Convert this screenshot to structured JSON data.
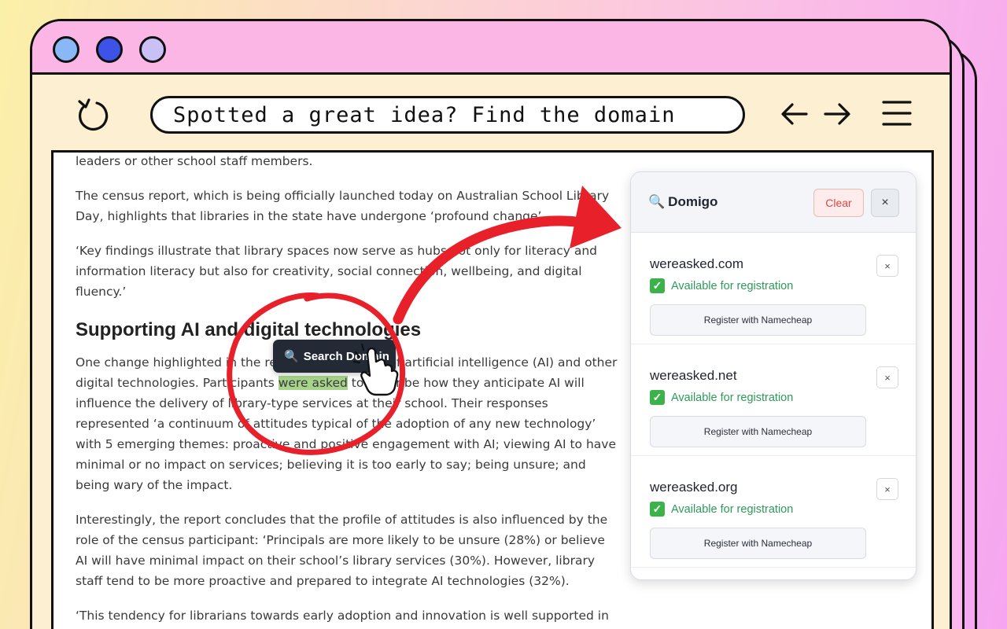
{
  "window": {
    "colors": {
      "dot1": "#8ab8f6",
      "dot2": "#3d52e6",
      "dot3": "#c9c0f6",
      "titlebar": "#fbb6e6"
    }
  },
  "toolbar": {
    "url_text": "Spotted a great idea? Find the domain",
    "icons": [
      "reload-icon",
      "back-arrow-icon",
      "forward-arrow-icon",
      "menu-icon"
    ]
  },
  "article": {
    "p0": "leaders or other school staff members.",
    "p1": "The census report, which is being officially launched today on Australian School Library Day, highlights that libraries in the state have undergone ‘profound change’.",
    "p2": "‘Key findings illustrate that library spaces now serve as hubs not only for literacy and information literacy but also for creativity, social connection, wellbeing, and digital fluency.’",
    "heading": "Supporting AI and digital technologies",
    "p3_before": "One change highlighted in the report is the impact of artificial intelligence (AI) and other digital technologies. Participants ",
    "p3_highlight": "were asked",
    "p3_after": " to describe how they anticipate AI will influence the delivery of library-type services at their school. Their responses represented ‘a continuum of attitudes typical of the adoption of any new technology’ with 5 emerging themes: proactive and positive engagement with AI; viewing AI to have minimal or no impact on services; believing it is too early to say; being unsure; and being wary of the impact.",
    "p4": "Interestingly, the report concludes that the profile of attitudes is also influenced by the role of the census participant: ‘Principals are more likely to be unsure (28%) or believe AI will have minimal impact on their school’s library services (30%). However, library staff tend to be more proactive and prepared to integrate AI technologies (32%).",
    "p5": "‘This tendency for librarians towards early adoption and innovation is well supported in"
  },
  "tooltip": {
    "label": "Search Domain",
    "icon": "magnifier-icon"
  },
  "panel": {
    "title": "Domigo",
    "clear_label": "Clear",
    "close_label": "×",
    "results": [
      {
        "domain": "wereasked.com",
        "status": "Available for registration",
        "remove": "×",
        "register": "Register with Namecheap"
      },
      {
        "domain": "wereasked.net",
        "status": "Available for registration",
        "remove": "×",
        "register": "Register with Namecheap"
      },
      {
        "domain": "wereasked.org",
        "status": "Available for registration",
        "remove": "×",
        "register": "Register with Namecheap"
      }
    ],
    "colors": {
      "available": "#2f9a58",
      "clear": "#d94a3e"
    }
  },
  "annotation": {
    "color": "#e8202a"
  }
}
